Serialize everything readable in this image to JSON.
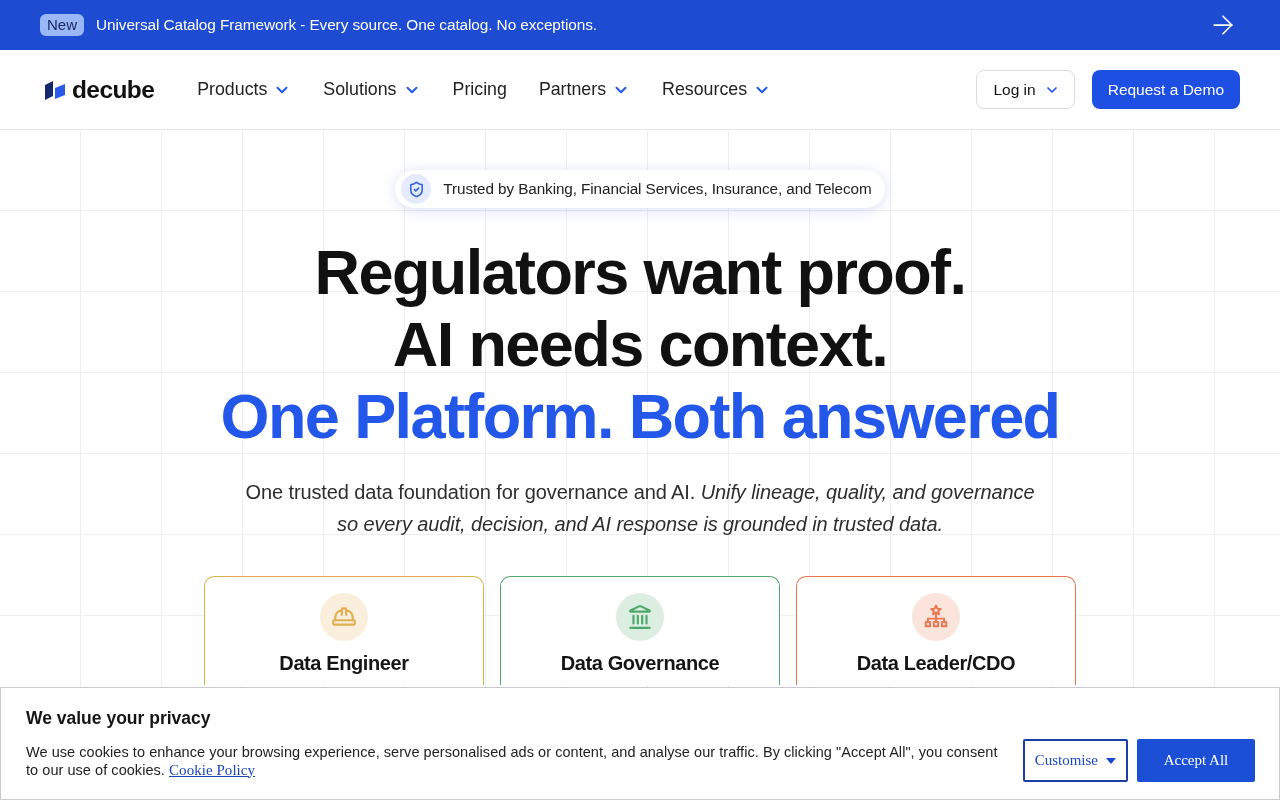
{
  "announcement": {
    "badge": "New",
    "text": "Universal Catalog Framework - Every source. One catalog. No exceptions."
  },
  "nav": {
    "logo": "decube",
    "items": [
      {
        "label": "Products",
        "dropdown": true
      },
      {
        "label": "Solutions",
        "dropdown": true
      },
      {
        "label": "Pricing",
        "dropdown": false
      },
      {
        "label": "Partners",
        "dropdown": true
      },
      {
        "label": "Resources",
        "dropdown": true
      }
    ],
    "login": {
      "label": "Log in",
      "dropdown": true
    },
    "cta": "Request a Demo"
  },
  "hero": {
    "trust_badge": "Trusted by Banking, Financial Services, Insurance, and Telecom",
    "headline": [
      {
        "text": "Regulators want proof.",
        "accent": false
      },
      {
        "text": "AI needs context.",
        "accent": false
      },
      {
        "text": "One Platform. Both answered",
        "accent": true
      }
    ],
    "subtitle": "One trusted data foundation for governance and AI. *Unify lineage, quality, and governance so every audit, decision, and AI response is grounded in trusted data.*"
  },
  "roles": [
    {
      "title": "Data Engineer",
      "kind": "helmet",
      "color": "#e0b04f"
    },
    {
      "title": "Data Governance",
      "kind": "bank",
      "color": "#4fa86b"
    },
    {
      "title": "Data Leader/CDO",
      "kind": "hierarchy",
      "color": "#e8764f"
    }
  ],
  "cookie_banner": {
    "title": "We value your privacy",
    "text": "We use cookies to enhance your browsing experience, serve personalised ads or content, and analyse our traffic. By clicking \"Accept All\", you consent to our use of cookies.",
    "link": "Cookie Policy",
    "buttons": [
      {
        "label": "Customise",
        "kind": "dropdown"
      },
      {
        "label": "Accept All",
        "kind": "primary"
      }
    ]
  }
}
